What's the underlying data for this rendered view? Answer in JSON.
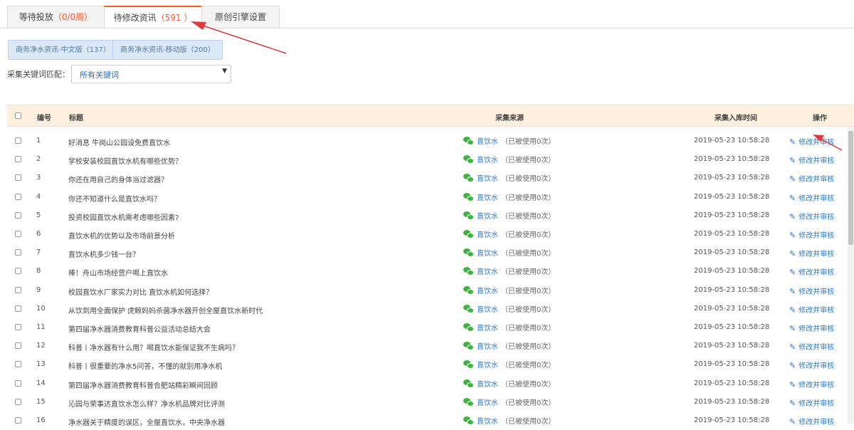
{
  "tabs": [
    {
      "label": "等待投放",
      "count": "（0/0周）"
    },
    {
      "label": "待修改资讯",
      "count": "（591 ）"
    },
    {
      "label": "原创引擎设置",
      "count": ""
    }
  ],
  "sub_buttons": [
    {
      "label": "商务净水资讯-中文版（137）"
    },
    {
      "label": "商务净水资讯-移动版（200）"
    }
  ],
  "keyword_filter": {
    "label": "采集关键词匹配：",
    "value": "所有关键词",
    "arrow": "▼"
  },
  "table": {
    "headers": {
      "num": "编号",
      "title": "标题",
      "source": "采集来源",
      "time": "采集入库时间",
      "action": "操作"
    },
    "rows": [
      {
        "num": "1",
        "title": "好消息 牛岗山公园设免费直饮水",
        "source": "直饮水",
        "usage": "（已被使用0次）",
        "time": "2019-05-23 10:58:28",
        "action": "修改并审核"
      },
      {
        "num": "2",
        "title": "学校安装校园直饮水机有哪些优势？",
        "source": "直饮水",
        "usage": "（已被使用0次）",
        "time": "2019-05-23 10:58:28",
        "action": "修改并审核"
      },
      {
        "num": "3",
        "title": "你还在用自己的身体当过滤器？",
        "source": "直饮水",
        "usage": "（已被使用0次）",
        "time": "2019-05-23 10:58:28",
        "action": "修改并审核"
      },
      {
        "num": "4",
        "title": "你还不知道什么是直饮水吗？",
        "source": "直饮水",
        "usage": "（已被使用0次）",
        "time": "2019-05-23 10:58:28",
        "action": "修改并审核"
      },
      {
        "num": "5",
        "title": "投资校园直饮水机需考虑哪些因素?",
        "source": "直饮水",
        "usage": "（已被使用0次）",
        "time": "2019-05-23 10:58:28",
        "action": "修改并审核"
      },
      {
        "num": "6",
        "title": "直饮水机的优势以及市场前景分析",
        "source": "直饮水",
        "usage": "（已被使用0次）",
        "time": "2019-05-23 10:58:28",
        "action": "修改并审核"
      },
      {
        "num": "7",
        "title": "直饮水机多少钱一台？",
        "source": "直饮水",
        "usage": "（已被使用0次）",
        "time": "2019-05-23 10:58:28",
        "action": "修改并审核"
      },
      {
        "num": "8",
        "title": "棒！舟山市场经营户喝上直饮水",
        "source": "直饮水",
        "usage": "（已被使用0次）",
        "time": "2019-05-23 10:58:28",
        "action": "修改并审核"
      },
      {
        "num": "9",
        "title": "校园直饮水厂家实力对比 直饮水机如何选择？",
        "source": "直饮水",
        "usage": "（已被使用0次）",
        "time": "2019-05-23 10:58:28",
        "action": "修改并审核"
      },
      {
        "num": "10",
        "title": "从饮到用全面保护 虎鲸妈妈杀菌净水器开创全屋直饮水新时代",
        "source": "直饮水",
        "usage": "（已被使用0次）",
        "time": "2019-05-23 10:58:28",
        "action": "修改并审核"
      },
      {
        "num": "11",
        "title": "第四届净水器消费教育科普公益活动总结大会",
        "source": "直饮水",
        "usage": "（已被使用0次）",
        "time": "2019-05-23 10:58:28",
        "action": "修改并审核"
      },
      {
        "num": "12",
        "title": "科普丨净水器有什么用？喝直饮水能保证我不生病吗？",
        "source": "直饮水",
        "usage": "（已被使用0次）",
        "time": "2019-05-23 10:58:28",
        "action": "修改并审核"
      },
      {
        "num": "13",
        "title": "科普丨很重要的净水5问答，不懂的就别用净水机",
        "source": "直饮水",
        "usage": "（已被使用0次）",
        "time": "2019-05-23 10:58:28",
        "action": "修改并审核"
      },
      {
        "num": "14",
        "title": "第四届净水器消费教育科普合肥站精彩瞬间回顾",
        "source": "直饮水",
        "usage": "（已被使用0次）",
        "time": "2019-05-23 10:58:28",
        "action": "修改并审核"
      },
      {
        "num": "15",
        "title": "沁园与荣事达直饮水怎么样？净水机品牌对比评测",
        "source": "直饮水",
        "usage": "（已被使用0次）",
        "time": "2019-05-23 10:58:28",
        "action": "修改并审核"
      },
      {
        "num": "16",
        "title": "净水器关于精度的误区，全屋直饮水，中央净水器",
        "source": "直饮水",
        "usage": "（已被使用0次）",
        "time": "2019-05-23 10:58:28",
        "action": "修改并审核"
      }
    ]
  },
  "icons": {
    "source": "wechat-icon",
    "action": "pencil-icon",
    "pencil_glyph": "✎"
  },
  "colors": {
    "accent": "#ef5a30",
    "link": "#2a7ad2",
    "header_bg": "#fdf0de",
    "annotation_arrow": "#e03a3a"
  }
}
